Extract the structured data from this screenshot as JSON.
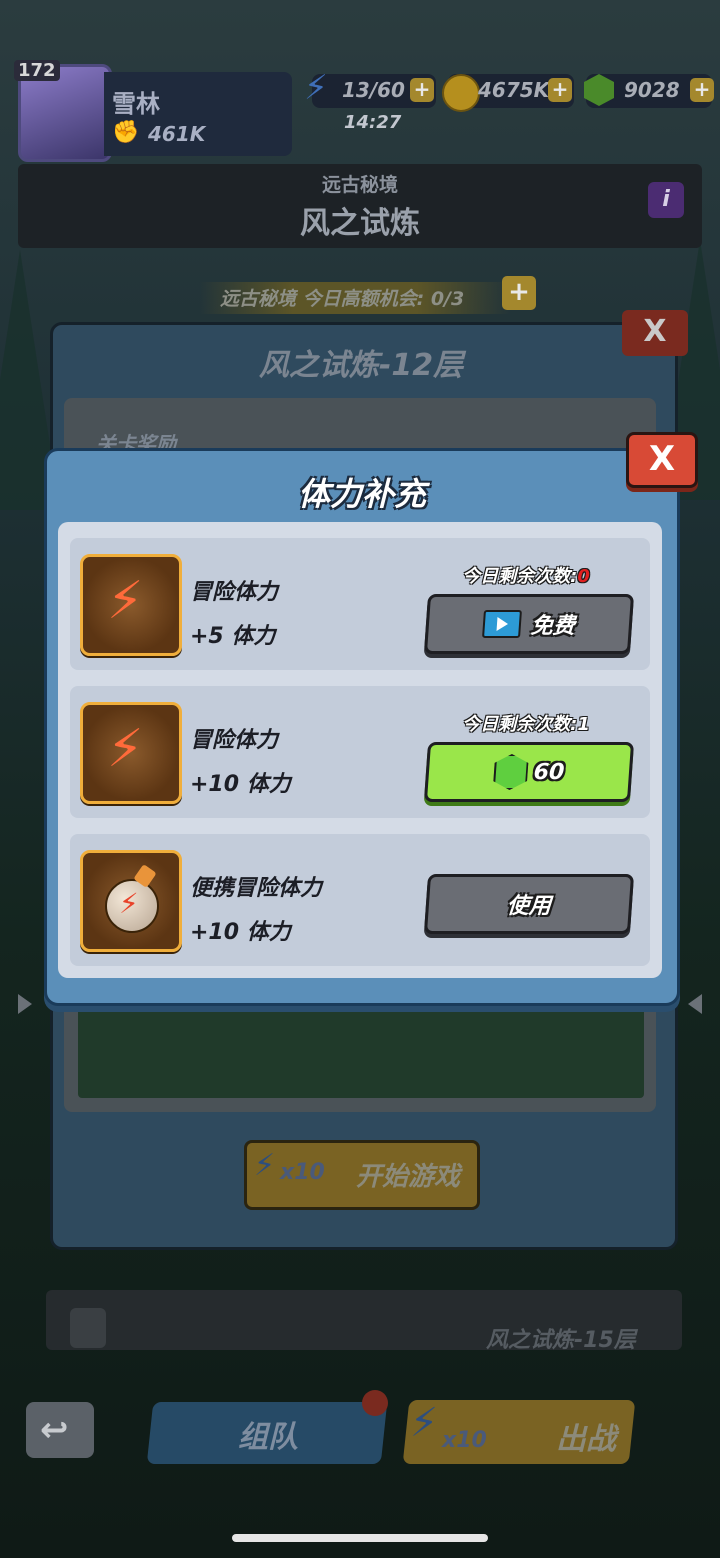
{
  "hud": {
    "level": "172",
    "player_name": "雪林",
    "power": "461K",
    "stamina": "13/60",
    "stamina_timer": "14:27",
    "gold": "4675K",
    "gems": "9028",
    "plus": "+"
  },
  "stage_header": {
    "subtitle": "远古秘境",
    "title": "风之试炼",
    "info": "i"
  },
  "chance_bar": {
    "text": "远古秘境 今日高额机会: 0/3",
    "plus": "+"
  },
  "back_panel": {
    "title": "风之试炼-12层",
    "reward_label": "关卡奖励",
    "start_cost": "x10",
    "start_label": "开始游戏",
    "close": "X",
    "next_floor": "风之试炼-15层"
  },
  "dialog": {
    "title": "体力补充",
    "close": "X",
    "rows": [
      {
        "icon": "lightning-icon",
        "name": "冒险体力",
        "amount": "+5 体力",
        "remain_label": "今日剩余次数:",
        "remain_count": "0",
        "button": "免费",
        "button_icon": "video-icon"
      },
      {
        "icon": "lightning-icon",
        "name": "冒险体力",
        "amount": "+10 体力",
        "remain_label": "今日剩余次数:",
        "remain_count": "1",
        "button": "60",
        "button_icon": "gem-icon"
      },
      {
        "icon": "potion-icon",
        "name": "便携冒险体力",
        "amount": "+10 体力",
        "button": "使用"
      }
    ]
  },
  "bottom_bar": {
    "team_label": "组队",
    "fight_cost": "x10",
    "fight_label": "出战"
  },
  "colors": {
    "accent_green": "#9ae64a",
    "close_red": "#d84a36",
    "dialog_blue": "#5b8fb9",
    "remain_zero": "#e02020"
  }
}
